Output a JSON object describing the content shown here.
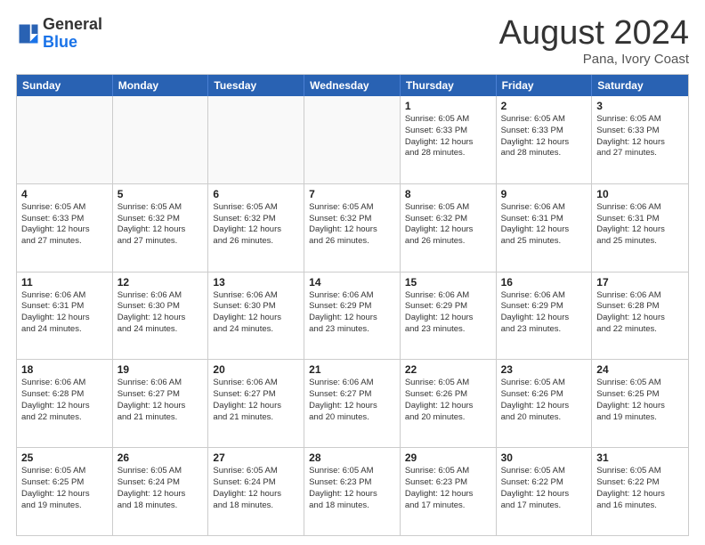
{
  "logo": {
    "text_general": "General",
    "text_blue": "Blue"
  },
  "header": {
    "month": "August 2024",
    "location": "Pana, Ivory Coast"
  },
  "day_names": [
    "Sunday",
    "Monday",
    "Tuesday",
    "Wednesday",
    "Thursday",
    "Friday",
    "Saturday"
  ],
  "weeks": [
    [
      {
        "day": "",
        "info": "",
        "shaded": true
      },
      {
        "day": "",
        "info": "",
        "shaded": true
      },
      {
        "day": "",
        "info": "",
        "shaded": true
      },
      {
        "day": "",
        "info": "",
        "shaded": true
      },
      {
        "day": "1",
        "info": "Sunrise: 6:05 AM\nSunset: 6:33 PM\nDaylight: 12 hours\nand 28 minutes.",
        "shaded": false
      },
      {
        "day": "2",
        "info": "Sunrise: 6:05 AM\nSunset: 6:33 PM\nDaylight: 12 hours\nand 28 minutes.",
        "shaded": false
      },
      {
        "day": "3",
        "info": "Sunrise: 6:05 AM\nSunset: 6:33 PM\nDaylight: 12 hours\nand 27 minutes.",
        "shaded": false
      }
    ],
    [
      {
        "day": "4",
        "info": "Sunrise: 6:05 AM\nSunset: 6:33 PM\nDaylight: 12 hours\nand 27 minutes.",
        "shaded": false
      },
      {
        "day": "5",
        "info": "Sunrise: 6:05 AM\nSunset: 6:32 PM\nDaylight: 12 hours\nand 27 minutes.",
        "shaded": false
      },
      {
        "day": "6",
        "info": "Sunrise: 6:05 AM\nSunset: 6:32 PM\nDaylight: 12 hours\nand 26 minutes.",
        "shaded": false
      },
      {
        "day": "7",
        "info": "Sunrise: 6:05 AM\nSunset: 6:32 PM\nDaylight: 12 hours\nand 26 minutes.",
        "shaded": false
      },
      {
        "day": "8",
        "info": "Sunrise: 6:05 AM\nSunset: 6:32 PM\nDaylight: 12 hours\nand 26 minutes.",
        "shaded": false
      },
      {
        "day": "9",
        "info": "Sunrise: 6:06 AM\nSunset: 6:31 PM\nDaylight: 12 hours\nand 25 minutes.",
        "shaded": false
      },
      {
        "day": "10",
        "info": "Sunrise: 6:06 AM\nSunset: 6:31 PM\nDaylight: 12 hours\nand 25 minutes.",
        "shaded": false
      }
    ],
    [
      {
        "day": "11",
        "info": "Sunrise: 6:06 AM\nSunset: 6:31 PM\nDaylight: 12 hours\nand 24 minutes.",
        "shaded": false
      },
      {
        "day": "12",
        "info": "Sunrise: 6:06 AM\nSunset: 6:30 PM\nDaylight: 12 hours\nand 24 minutes.",
        "shaded": false
      },
      {
        "day": "13",
        "info": "Sunrise: 6:06 AM\nSunset: 6:30 PM\nDaylight: 12 hours\nand 24 minutes.",
        "shaded": false
      },
      {
        "day": "14",
        "info": "Sunrise: 6:06 AM\nSunset: 6:29 PM\nDaylight: 12 hours\nand 23 minutes.",
        "shaded": false
      },
      {
        "day": "15",
        "info": "Sunrise: 6:06 AM\nSunset: 6:29 PM\nDaylight: 12 hours\nand 23 minutes.",
        "shaded": false
      },
      {
        "day": "16",
        "info": "Sunrise: 6:06 AM\nSunset: 6:29 PM\nDaylight: 12 hours\nand 23 minutes.",
        "shaded": false
      },
      {
        "day": "17",
        "info": "Sunrise: 6:06 AM\nSunset: 6:28 PM\nDaylight: 12 hours\nand 22 minutes.",
        "shaded": false
      }
    ],
    [
      {
        "day": "18",
        "info": "Sunrise: 6:06 AM\nSunset: 6:28 PM\nDaylight: 12 hours\nand 22 minutes.",
        "shaded": false
      },
      {
        "day": "19",
        "info": "Sunrise: 6:06 AM\nSunset: 6:27 PM\nDaylight: 12 hours\nand 21 minutes.",
        "shaded": false
      },
      {
        "day": "20",
        "info": "Sunrise: 6:06 AM\nSunset: 6:27 PM\nDaylight: 12 hours\nand 21 minutes.",
        "shaded": false
      },
      {
        "day": "21",
        "info": "Sunrise: 6:06 AM\nSunset: 6:27 PM\nDaylight: 12 hours\nand 20 minutes.",
        "shaded": false
      },
      {
        "day": "22",
        "info": "Sunrise: 6:05 AM\nSunset: 6:26 PM\nDaylight: 12 hours\nand 20 minutes.",
        "shaded": false
      },
      {
        "day": "23",
        "info": "Sunrise: 6:05 AM\nSunset: 6:26 PM\nDaylight: 12 hours\nand 20 minutes.",
        "shaded": false
      },
      {
        "day": "24",
        "info": "Sunrise: 6:05 AM\nSunset: 6:25 PM\nDaylight: 12 hours\nand 19 minutes.",
        "shaded": false
      }
    ],
    [
      {
        "day": "25",
        "info": "Sunrise: 6:05 AM\nSunset: 6:25 PM\nDaylight: 12 hours\nand 19 minutes.",
        "shaded": false
      },
      {
        "day": "26",
        "info": "Sunrise: 6:05 AM\nSunset: 6:24 PM\nDaylight: 12 hours\nand 18 minutes.",
        "shaded": false
      },
      {
        "day": "27",
        "info": "Sunrise: 6:05 AM\nSunset: 6:24 PM\nDaylight: 12 hours\nand 18 minutes.",
        "shaded": false
      },
      {
        "day": "28",
        "info": "Sunrise: 6:05 AM\nSunset: 6:23 PM\nDaylight: 12 hours\nand 18 minutes.",
        "shaded": false
      },
      {
        "day": "29",
        "info": "Sunrise: 6:05 AM\nSunset: 6:23 PM\nDaylight: 12 hours\nand 17 minutes.",
        "shaded": false
      },
      {
        "day": "30",
        "info": "Sunrise: 6:05 AM\nSunset: 6:22 PM\nDaylight: 12 hours\nand 17 minutes.",
        "shaded": false
      },
      {
        "day": "31",
        "info": "Sunrise: 6:05 AM\nSunset: 6:22 PM\nDaylight: 12 hours\nand 16 minutes.",
        "shaded": false
      }
    ]
  ]
}
